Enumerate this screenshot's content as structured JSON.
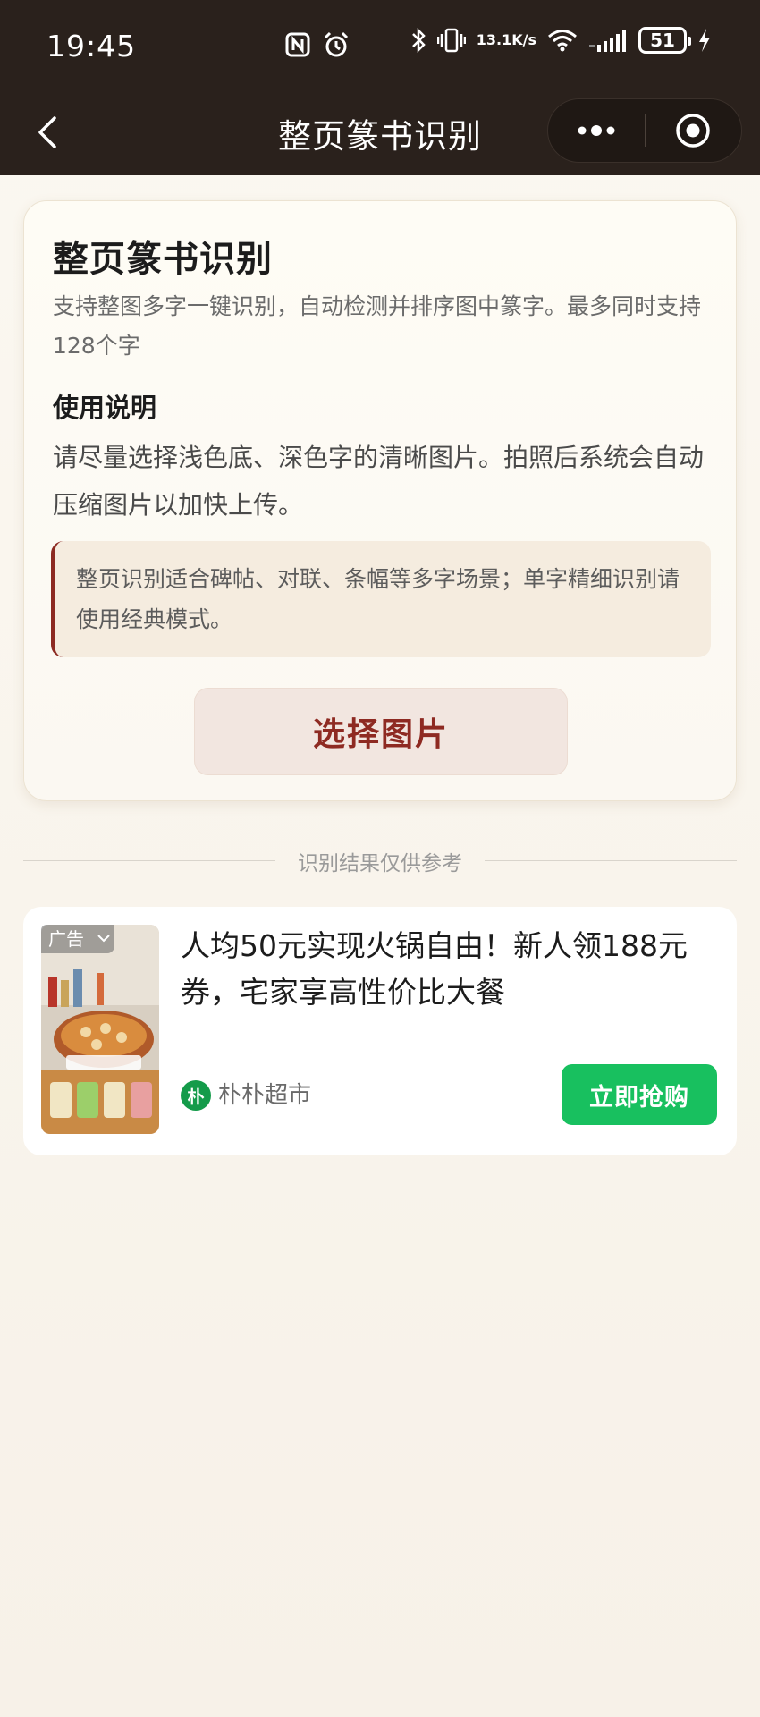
{
  "status_bar": {
    "time": "19:45",
    "net_speed_value": "13.1",
    "net_speed_unit": "K/s",
    "battery": "51",
    "icons": [
      "nfc-icon",
      "alarm-icon",
      "bluetooth-icon",
      "vibrate-icon",
      "wifi-icon",
      "signal-icon",
      "battery-icon",
      "charging-icon"
    ]
  },
  "nav": {
    "title": "整页篆书识别",
    "back_icon": "chevron-left-icon",
    "more_icon": "more-dots-icon",
    "close_icon": "target-circle-icon"
  },
  "card": {
    "title": "整页篆书识别",
    "description": "支持整图多字一键识别，自动检测并排序图中篆字。最多同时支持128个字",
    "usage_heading": "使用说明",
    "usage_text": "请尽量选择浅色底、深色字的清晰图片。拍照后系统会自动压缩图片以加快上传。",
    "note": "整页识别适合碑帖、对联、条幅等多字场景；单字精细识别请使用经典模式。",
    "choose_button": "选择图片"
  },
  "divider": {
    "text": "识别结果仅供参考"
  },
  "ad": {
    "badge": "广告",
    "headline": "人均50元实现火锅自由！新人领188元券，宅家享高性价比大餐",
    "brand_logo_text": "朴",
    "brand_name": "朴朴超市",
    "cta": "立即抢购"
  },
  "colors": {
    "header_bg": "#2a211c",
    "accent_red": "#8e2a22",
    "cta_green": "#18c05f",
    "brand_green": "#149b4a"
  }
}
